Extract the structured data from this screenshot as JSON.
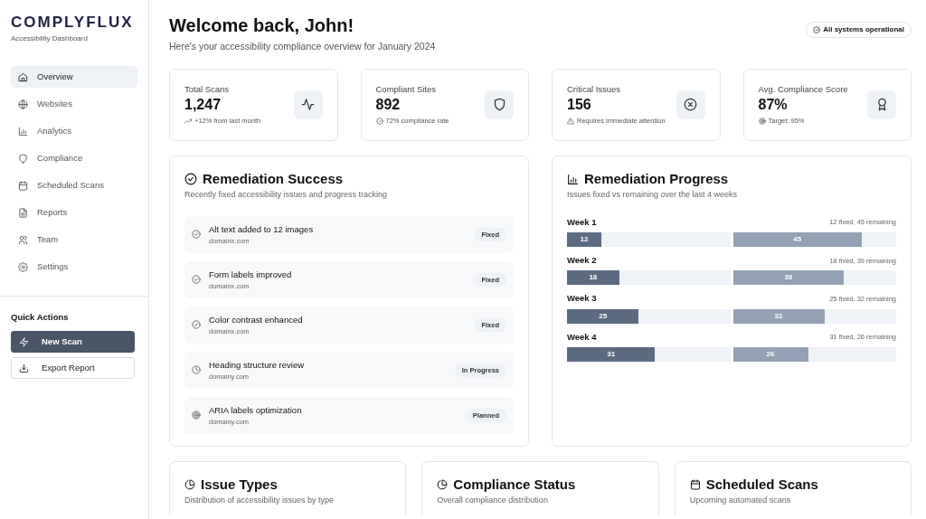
{
  "brand": {
    "logo": "COMPLYFLUX",
    "tagline": "Accessibility Dashboard"
  },
  "sidebar": {
    "items": [
      {
        "label": "Overview",
        "selected": true
      },
      {
        "label": "Websites",
        "selected": false
      },
      {
        "label": "Analytics",
        "selected": false
      },
      {
        "label": "Compliance",
        "selected": false
      },
      {
        "label": "Scheduled Scans",
        "selected": false
      },
      {
        "label": "Reports",
        "selected": false
      },
      {
        "label": "Team",
        "selected": false
      },
      {
        "label": "Settings",
        "selected": false
      }
    ],
    "quick_actions": {
      "title": "Quick Actions",
      "buttons": [
        {
          "label": "New Scan",
          "kind": "primary"
        },
        {
          "label": "Export Report",
          "kind": "outline"
        }
      ]
    }
  },
  "header": {
    "title": "Welcome back, John!",
    "subtitle": "Here's your accessibility compliance overview for January 2024",
    "status": "All systems operational"
  },
  "stats": [
    {
      "label": "Total Scans",
      "value": "1,247",
      "note": "+12% from last month"
    },
    {
      "label": "Compliant Sites",
      "value": "892",
      "note": "72% compliance rate"
    },
    {
      "label": "Critical Issues",
      "value": "156",
      "note": "Requires immediate attention"
    },
    {
      "label": "Avg. Compliance Score",
      "value": "87%",
      "note": "Target: 95%"
    }
  ],
  "remediation_success": {
    "title": "Remediation Success",
    "subtitle": "Recently fixed accessibility issues and progress tracking",
    "items": [
      {
        "title": "Alt text added to 12 images",
        "domain": "domainx.com",
        "status": "Fixed",
        "kind": "fixed"
      },
      {
        "title": "Form labels improved",
        "domain": "domainx.com",
        "status": "Fixed",
        "kind": "fixed"
      },
      {
        "title": "Color contrast enhanced",
        "domain": "domainx.com",
        "status": "Fixed",
        "kind": "fixed"
      },
      {
        "title": "Heading structure review",
        "domain": "domainy.com",
        "status": "In Progress",
        "kind": "progress"
      },
      {
        "title": "ARIA labels optimization",
        "domain": "domainy.com",
        "status": "Planned",
        "kind": "planned"
      }
    ]
  },
  "remediation_progress": {
    "title": "Remediation Progress",
    "subtitle": "Issues fixed vs remaining over the last 4 weeks",
    "weeks": [
      {
        "label": "Week 1",
        "summary": "12 fixed, 45 remaining",
        "fixed": {
          "text": "12",
          "level": 0.21
        },
        "remaining": {
          "text": "45",
          "level": 0.79
        }
      },
      {
        "label": "Week 2",
        "summary": "18 fixed, 39 remaining",
        "fixed": {
          "text": "18",
          "level": 0.32
        },
        "remaining": {
          "text": "39",
          "level": 0.68
        }
      },
      {
        "label": "Week 3",
        "summary": "25 fixed, 32 remaining",
        "fixed": {
          "text": "25",
          "level": 0.44
        },
        "remaining": {
          "text": "32",
          "level": 0.56
        }
      },
      {
        "label": "Week 4",
        "summary": "31 fixed, 26 remaining",
        "fixed": {
          "text": "31",
          "level": 0.54
        },
        "remaining": {
          "text": "26",
          "level": 0.46
        }
      }
    ]
  },
  "bottom_cards": [
    {
      "title": "Issue Types",
      "subtitle": "Distribution of accessibility issues by type"
    },
    {
      "title": "Compliance Status",
      "subtitle": "Overall compliance distribution"
    },
    {
      "title": "Scheduled Scans",
      "subtitle": "Upcoming automated scans"
    }
  ]
}
